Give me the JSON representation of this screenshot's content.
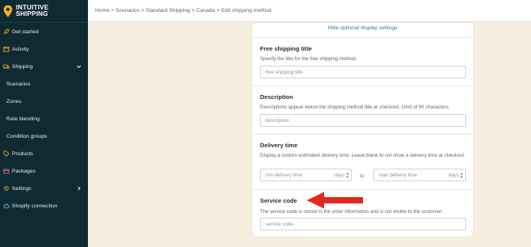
{
  "sidebar": {
    "brand_line1": "INTUITIVE",
    "brand_line2": "SHIPPING",
    "items": [
      {
        "label": "Get started",
        "icon": "rocket-icon"
      },
      {
        "label": "Activity",
        "icon": "activity-icon"
      },
      {
        "label": "Shipping",
        "icon": "truck-icon",
        "expanded": true
      },
      {
        "label": "Scenarios"
      },
      {
        "label": "Zones"
      },
      {
        "label": "Rate blending"
      },
      {
        "label": "Condition groups"
      },
      {
        "label": "Products",
        "icon": "tag-icon"
      },
      {
        "label": "Packages",
        "icon": "box-icon"
      },
      {
        "label": "Settings",
        "icon": "gear-icon"
      },
      {
        "label": "Shopify connection",
        "icon": "cloud-icon"
      }
    ]
  },
  "breadcrumb": "Home > Scenarios > Standard Shipping > Canada > Edit shipping method",
  "form": {
    "hide_link": "Hide optional display settings",
    "free_title": "Free shipping title",
    "free_desc": "Specify the title for the free shipping method.",
    "free_placeholder": "free shipping title",
    "desc_title": "Description",
    "desc_desc": "Descriptions appear below the shipping method title at checkout. Limit of 90 characters.",
    "desc_placeholder": "description",
    "delivery_title": "Delivery time",
    "delivery_desc": "Display a custom estimated delivery time. Leave blank to not show a delivery time at checkout.",
    "min_placeholder": "min delivery time",
    "max_placeholder": "max delivery time",
    "unit": "days",
    "to": "to",
    "service_title": "Service code",
    "service_desc": "The service code is stored in the order information and is not visible to the customer.",
    "service_placeholder": "service code"
  },
  "colors": {
    "sidebar_bg": "#0f2a33",
    "accent": "#f2b01e",
    "link": "#2b79a8",
    "arrow": "#e3261e",
    "page_bg": "#f6efe0"
  }
}
